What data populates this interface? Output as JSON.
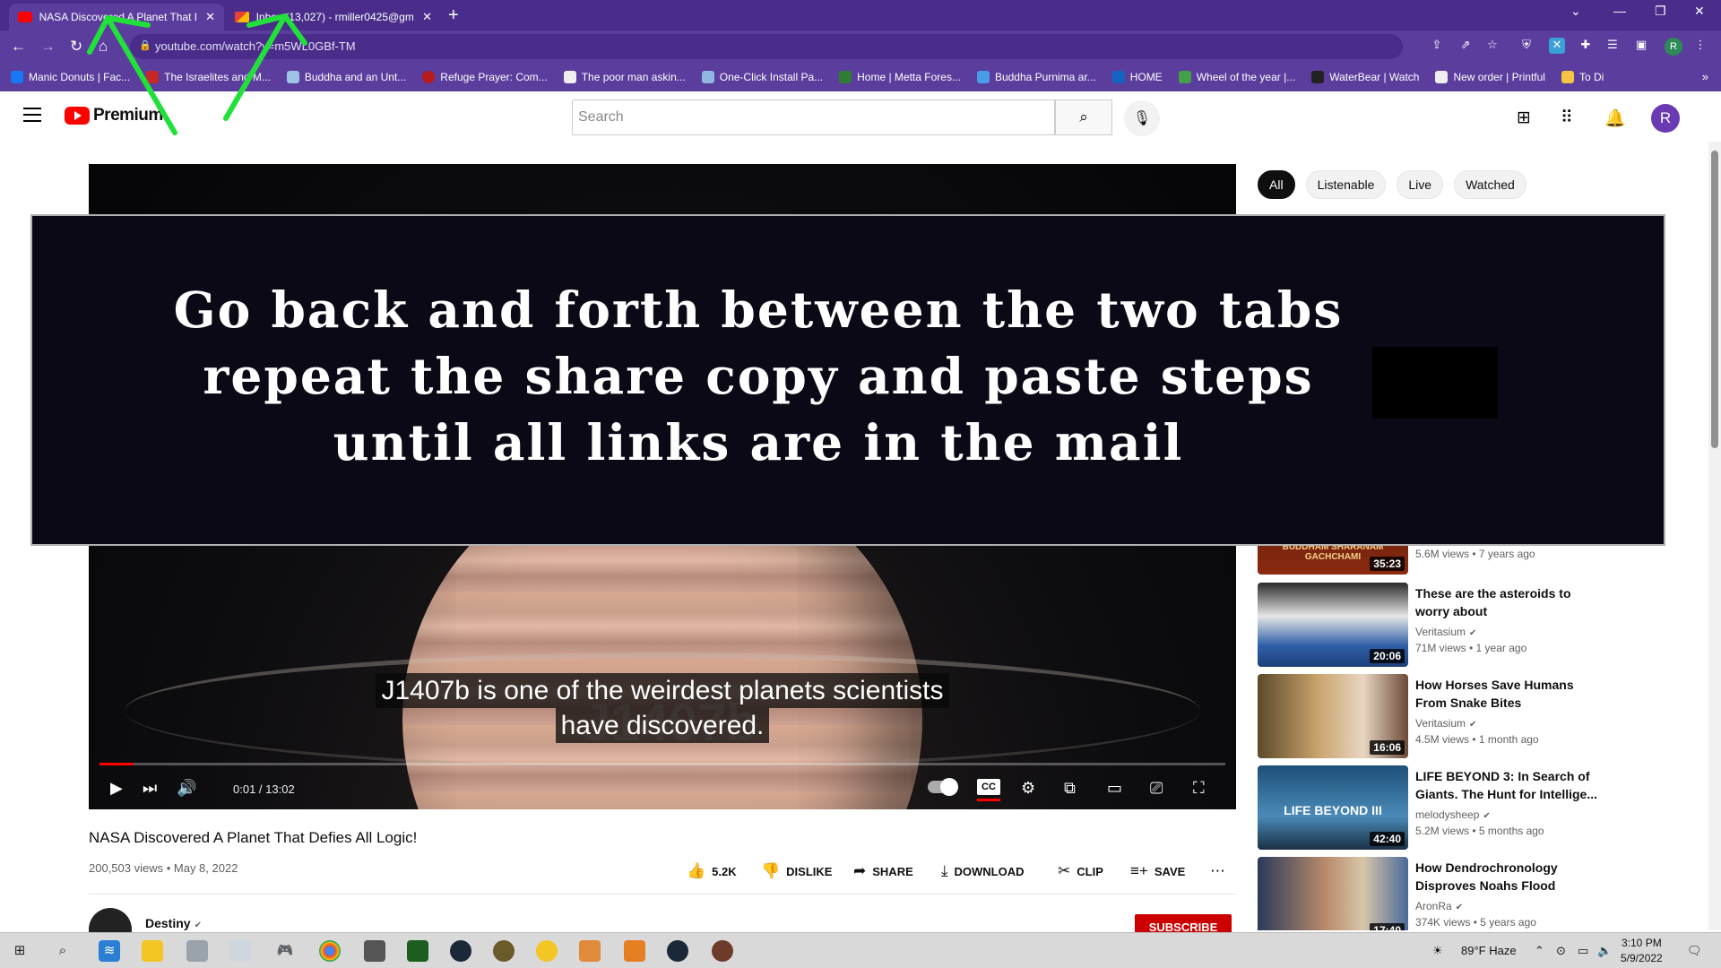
{
  "browser": {
    "tabs": [
      {
        "title": "NASA Discovered A Planet That D",
        "active": true,
        "favicon": "youtube-favicon"
      },
      {
        "title": "Inbox (13,027) - rmiller0425@gm",
        "active": false,
        "favicon": "gmail-favicon"
      }
    ],
    "url": "youtube.com/watch?v=m5WL0GBf-TM",
    "bookmarks": [
      "Manic Donuts | Fac...",
      "The Israelites and M...",
      "Buddha and an Unt...",
      "Refuge Prayer: Com...",
      "The poor man askin...",
      "One-Click Install Pa...",
      "Home | Metta Fores...",
      "Buddha Purnima ar...",
      "HOME",
      "Wheel of the year |...",
      "WaterBear | Watch",
      "New order | Printful",
      "To Di"
    ],
    "profile_initial": "R"
  },
  "youtube": {
    "logo_text": "Premium",
    "search_placeholder": "Search",
    "avatar_initial": "R"
  },
  "player": {
    "caption_line1": "J1407b is one of the weirdest planets scientists",
    "caption_line2": "have discovered.",
    "background_text": "J1407b",
    "timecode": "0:01 / 13:02",
    "progress_fraction": 0.03,
    "cc_label": "CC"
  },
  "overlay": {
    "line1": "Go back and forth between the two tabs",
    "line2": "repeat the share copy and paste steps",
    "line3": "until all links are in the mail"
  },
  "video": {
    "title": "NASA Discovered A Planet That Defies All Logic!",
    "meta": "200,503 views • May 8, 2022",
    "likes": "5.2K",
    "dislike": "DISLIKE",
    "share": "SHARE",
    "download": "DOWNLOAD",
    "clip": "CLIP",
    "save": "SAVE",
    "channel": "Destiny",
    "subscribe": "SUBSCRIBE"
  },
  "chips": [
    "All",
    "Listenable",
    "Live",
    "Watched"
  ],
  "recommendations_partial": {
    "thumb_text": "BUDDHAM SHARANAM GACHCHAMI",
    "duration": "35:23",
    "meta": "5.6M views • 7 years ago"
  },
  "recommendations": [
    {
      "title": "These are the asteroids to worry about",
      "channel": "Veritasium",
      "meta": "71M views • 1 year ago",
      "duration": "20:06"
    },
    {
      "title": "How Horses Save Humans From Snake Bites",
      "channel": "Veritasium",
      "meta": "4.5M views • 1 month ago",
      "duration": "16:06"
    },
    {
      "title": "LIFE BEYOND 3: In Search of Giants. The Hunt for Intellige...",
      "channel": "melodysheep",
      "meta": "5.2M views • 5 months ago",
      "duration": "42:40",
      "thumb_text": "LIFE BEYOND III"
    },
    {
      "title": "How Dendrochronology Disproves Noahs Flood",
      "channel": "AronRa",
      "meta": "374K views • 5 years ago",
      "duration": "17:40"
    }
  ],
  "taskbar": {
    "weather": "89°F  Haze",
    "time": "3:10 PM",
    "date": "5/9/2022"
  },
  "colors": {
    "chrome_frame": "#4a2d8a",
    "youtube_red": "#ff0000",
    "arrow_green": "#22e03a"
  }
}
